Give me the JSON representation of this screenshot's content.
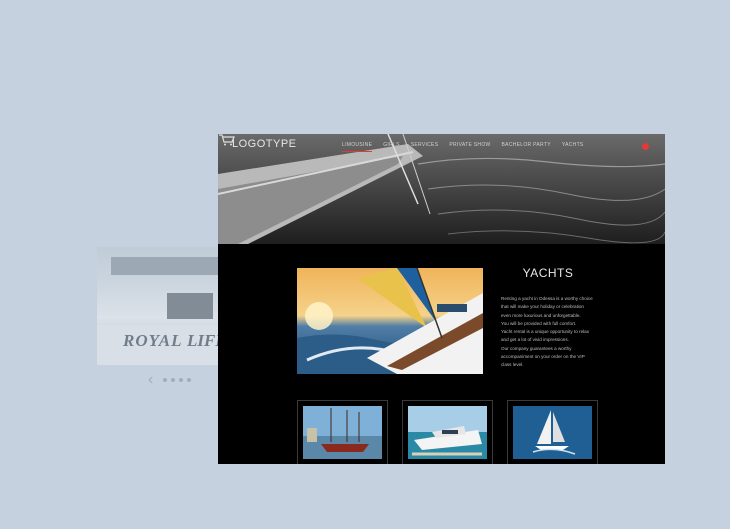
{
  "background_card": {
    "text_left": "ROYAL",
    "text_right": "LIFE"
  },
  "background_nav": {
    "prev_icon": "‹",
    "dots_count": 4
  },
  "header": {
    "logo": "LOGOTYPE",
    "menu": [
      {
        "label": "LIMOUSINE",
        "active": true
      },
      {
        "label": "GIRLS",
        "active": false
      },
      {
        "label": "SERVICES",
        "active": false
      },
      {
        "label": "PRIVATE SHOW",
        "active": false
      },
      {
        "label": "BACHELOR PARTY",
        "active": false
      },
      {
        "label": "YACHTS",
        "active": false
      }
    ],
    "cart_icon": "cart-icon"
  },
  "section": {
    "title": "YACHTS",
    "description": [
      "Renting a yacht in Odessa is a worthy choice that will make your holiday or celebration even more luxurious and unforgettable.",
      "You will be provided with full comfort.",
      "Yacht rental is a unique opportunity to relax and get a lot of vivid impressions.",
      "Our company guarantees a worthy accompaniment on your order on the VIP class level."
    ]
  },
  "thumbnails": [
    "sailing-ship-harbor",
    "motor-yacht-dock",
    "sailboat-sea"
  ],
  "colors": {
    "accent": "#e53935",
    "page_bg": "#c5d1df",
    "site_bg": "#000000"
  }
}
